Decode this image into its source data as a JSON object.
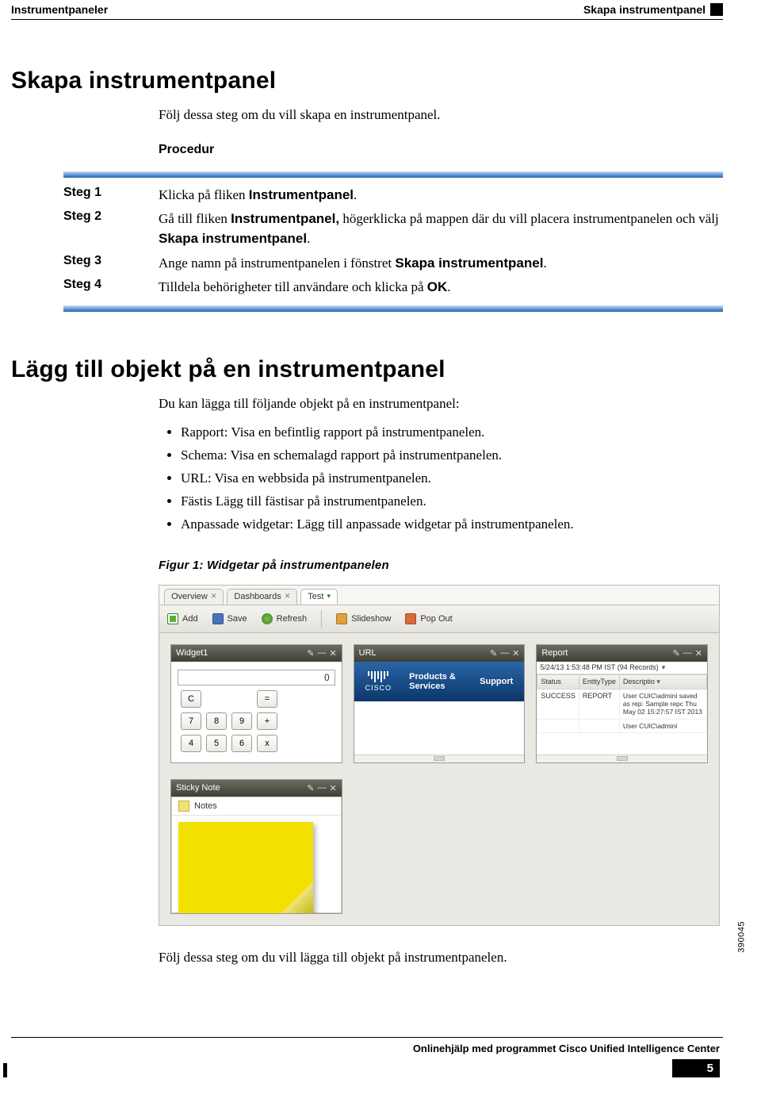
{
  "header": {
    "left": "Instrumentpaneler",
    "right": "Skapa instrumentpanel"
  },
  "section1": {
    "title": "Skapa instrumentpanel",
    "intro": "Följ dessa steg om du vill skapa en instrumentpanel.",
    "procedure_label": "Procedur",
    "steps": [
      {
        "label": "Steg 1",
        "text1": "Klicka på fliken ",
        "bold1": "Instrumentpanel",
        "text2": ".",
        "bold2": "",
        "text3": ""
      },
      {
        "label": "Steg 2",
        "text1": "Gå till fliken ",
        "bold1": "Instrumentpanel,",
        "text2": " högerklicka på mappen där du vill placera instrumentpanelen och välj ",
        "bold2": "Skapa instrumentpanel",
        "text3": "."
      },
      {
        "label": "Steg 3",
        "text1": "Ange namn på instrumentpanelen i fönstret ",
        "bold1": "Skapa instrumentpanel",
        "text2": ".",
        "bold2": "",
        "text3": ""
      },
      {
        "label": "Steg 4",
        "text1": "Tilldela behörigheter till användare och klicka på ",
        "bold1": "OK",
        "text2": ".",
        "bold2": "",
        "text3": ""
      }
    ]
  },
  "section2": {
    "title": "Lägg till objekt på en instrumentpanel",
    "intro": "Du kan lägga till följande objekt på en instrumentpanel:",
    "bullets": [
      "Rapport: Visa en befintlig rapport på instrumentpanelen.",
      "Schema: Visa en schemalagd rapport på instrumentpanelen.",
      "URL: Visa en webbsida på instrumentpanelen.",
      "Fästis Lägg till fästisar på instrumentpanelen.",
      "Anpassade widgetar: Lägg till anpassade widgetar på instrumentpanelen."
    ],
    "figure_caption": "Figur 1: Widgetar på instrumentpanelen",
    "after_figure": "Följ dessa steg om du vill lägga till objekt på instrumentpanelen."
  },
  "screenshot": {
    "tabs": [
      "Overview",
      "Dashboards",
      "Test"
    ],
    "toolbar": {
      "add": "Add",
      "save": "Save",
      "refresh": "Refresh",
      "slideshow": "Slideshow",
      "popout": "Pop Out"
    },
    "widget_calc": {
      "title": "Widget1",
      "display": "0",
      "keys": [
        "C",
        "",
        "",
        "=",
        "7",
        "8",
        "9",
        "+",
        "4",
        "5",
        "6",
        "x"
      ]
    },
    "widget_url": {
      "title": "URL",
      "brand": "CISCO",
      "nav1": "Products & Services",
      "nav2": "Support"
    },
    "widget_report": {
      "title": "Report",
      "stamp": "5/24/13 1:53:48 PM IST (94 Records)",
      "cols": [
        "Status",
        "EntityType",
        "Descriptio"
      ],
      "row": {
        "status": "SUCCESS",
        "entity": "REPORT",
        "desc": "User CUIC\\admini saved as rep: Sample repc Thu May 02 15:27:57 IST 2013"
      },
      "trail": "User CUIC\\admini"
    },
    "widget_sticky": {
      "title": "Sticky Note",
      "label": "Notes"
    },
    "figure_id": "390045"
  },
  "footer": {
    "text": "Onlinehjälp med programmet Cisco Unified Intelligence Center",
    "page": "5"
  }
}
